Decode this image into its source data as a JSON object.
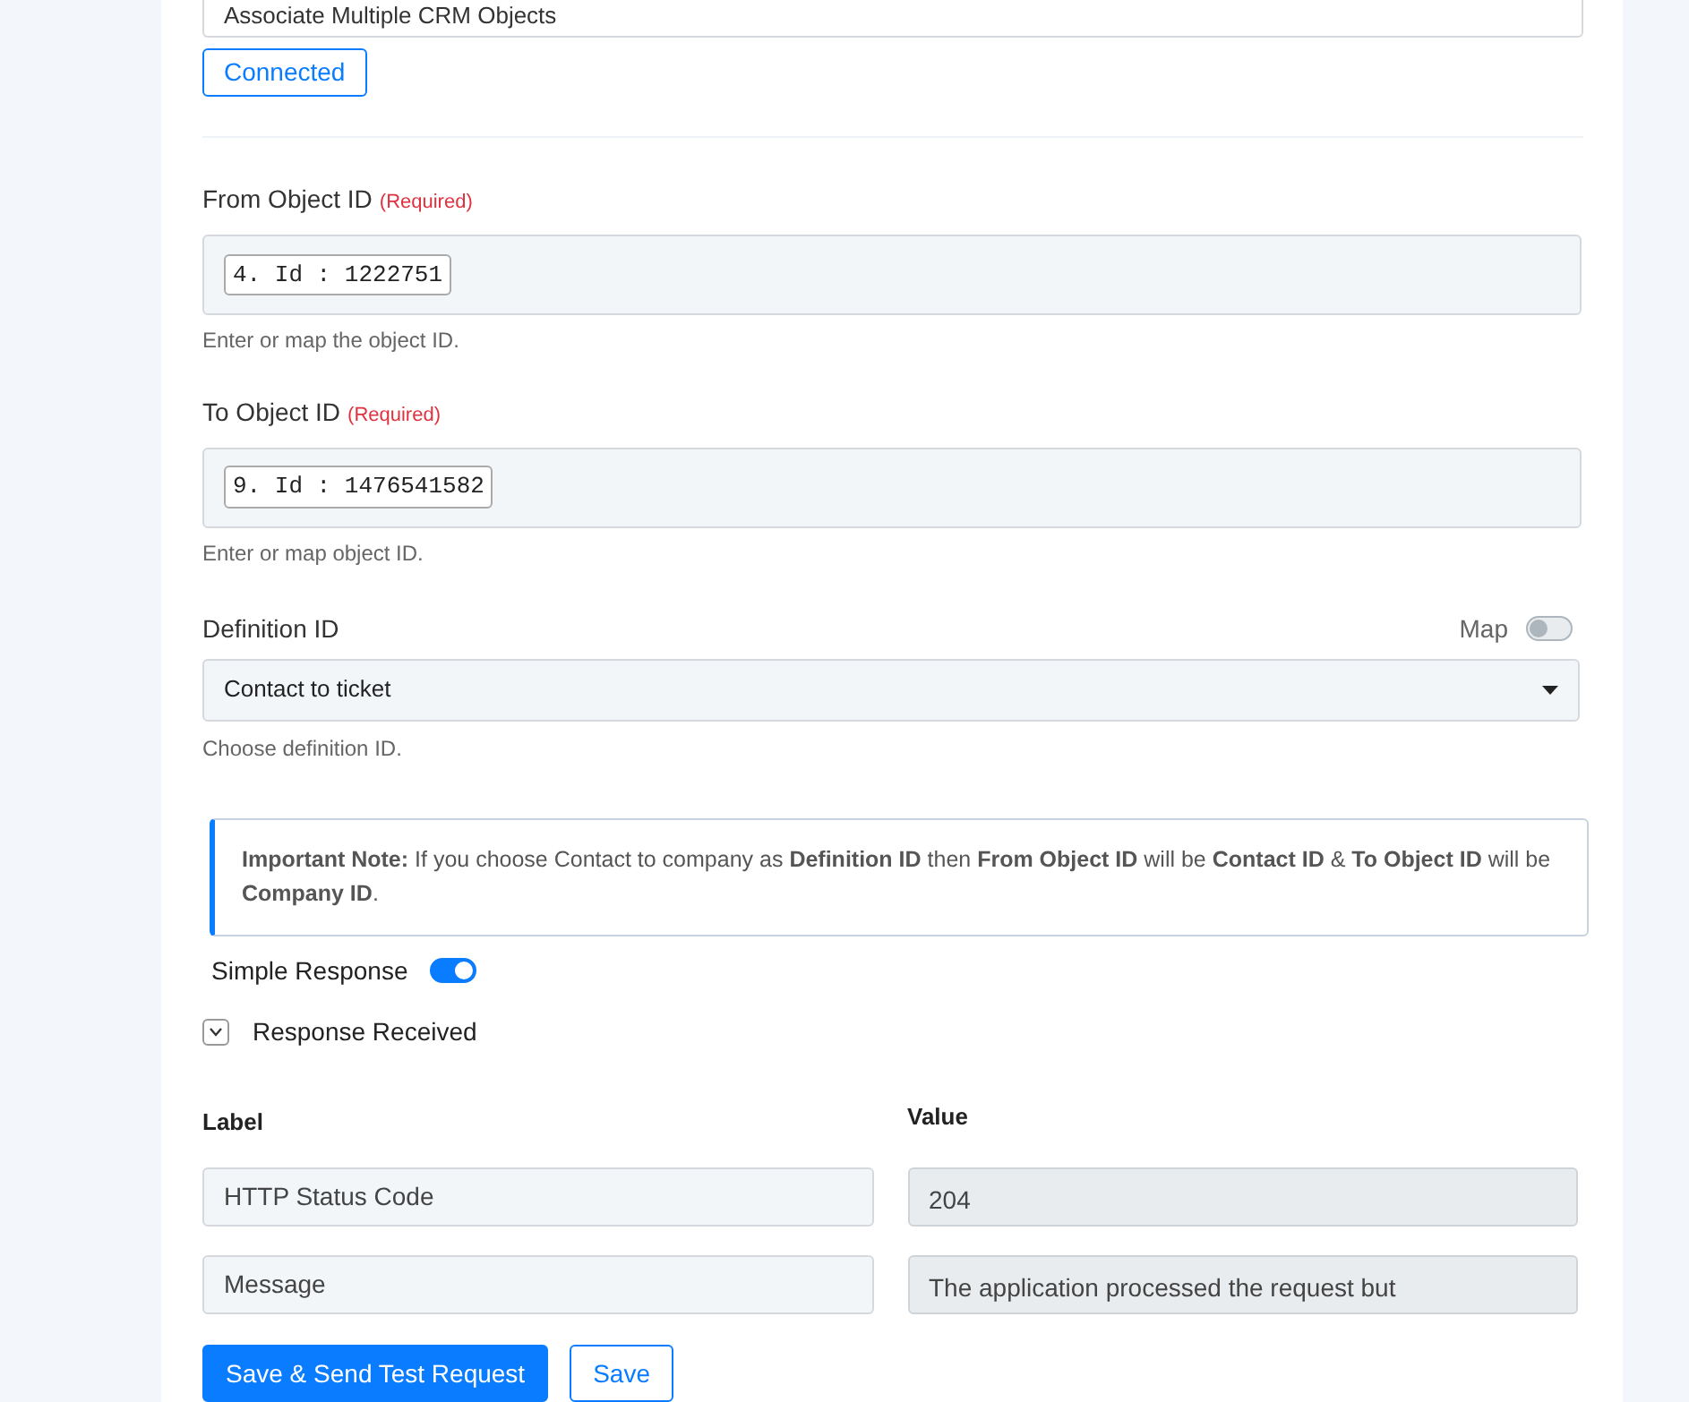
{
  "event_field": {
    "value": "Associate Multiple CRM Objects"
  },
  "connection_button": "Connected",
  "from_object": {
    "label": "From Object ID",
    "required": "(Required)",
    "token": "4. Id : 1222751",
    "help": "Enter or map the object ID."
  },
  "to_object": {
    "label": "To Object ID",
    "required": "(Required)",
    "token": "9. Id : 1476541582",
    "help": "Enter or map object ID."
  },
  "definition": {
    "label": "Definition ID",
    "map_label": "Map",
    "map_on": false,
    "value": "Contact to ticket",
    "help": "Choose definition ID."
  },
  "note": "**Important Note:** If you choose Contact to company as **Definition ID** then **From Object ID** will be **Contact ID** & **To Object ID** will be **Company ID**.",
  "simple_response": {
    "label": "Simple Response",
    "on": true
  },
  "response": {
    "label": "Response Received",
    "expanded": true,
    "columns": [
      "Label",
      "Value"
    ],
    "rows": [
      {
        "label": "HTTP Status Code",
        "value": "204"
      },
      {
        "label": "Message",
        "value": "The application processed the request but"
      }
    ]
  },
  "buttons": [
    {
      "label": "Save & Send Test Request",
      "kind": "primary"
    },
    {
      "label": "Save",
      "kind": "secondary"
    }
  ]
}
